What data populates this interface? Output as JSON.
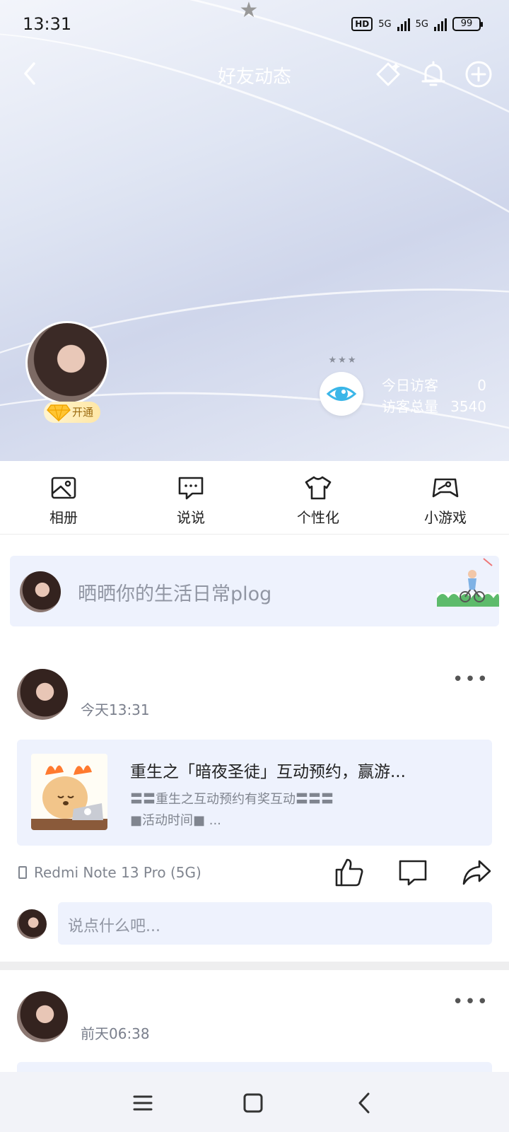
{
  "status_bar": {
    "time": "13:31",
    "hd_label": "HD",
    "net1": "5G",
    "net2": "5G",
    "battery": "99"
  },
  "nav": {
    "title": "好友动态"
  },
  "profile": {
    "vip_label": "开通",
    "visitors_today_label": "今日访客",
    "visitors_today_value": "0",
    "visitors_total_label": "访客总量",
    "visitors_total_value": "3540"
  },
  "quick_menu": [
    {
      "label": "相册",
      "icon": "album-icon"
    },
    {
      "label": "说说",
      "icon": "message-icon"
    },
    {
      "label": "个性化",
      "icon": "tshirt-icon"
    },
    {
      "label": "小游戏",
      "icon": "game-icon"
    }
  ],
  "post_box": {
    "placeholder": "晒晒你的生活日常plog"
  },
  "feed": [
    {
      "time": "今天13:31",
      "shared_title": "重生之「暗夜圣徒」互动预约，赢游...",
      "shared_desc_line1": "〓〓重生之互动预约有奖互动〓〓〓",
      "shared_desc_line2": "■活动时间■ ...",
      "device": "Redmi Note 13 Pro (5G)",
      "comment_placeholder": "说点什么吧..."
    },
    {
      "time": "前天06:38"
    }
  ],
  "colors": {
    "accent_eye": "#3bb6e8",
    "card_bg": "#eef2fd",
    "vip_gold": "#ffc533"
  }
}
